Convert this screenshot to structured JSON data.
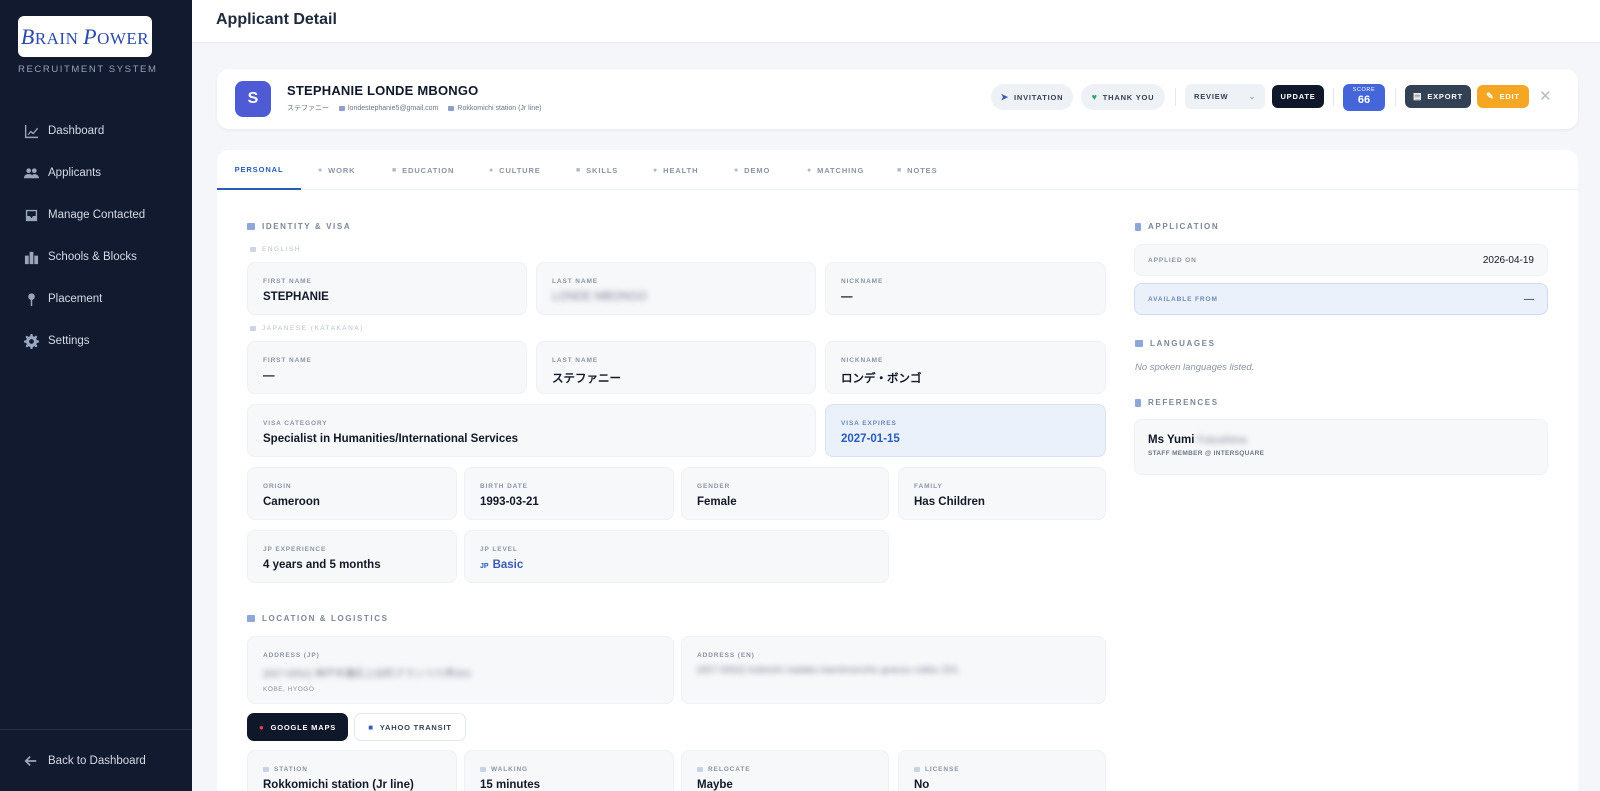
{
  "brand": {
    "logo_text": "BRAIN POWER",
    "subtitle": "RECRUITMENT SYSTEM"
  },
  "sidebar": {
    "items": [
      {
        "label": "Dashboard",
        "icon": "chart-line-icon"
      },
      {
        "label": "Applicants",
        "icon": "users-icon"
      },
      {
        "label": "Manage Contacted",
        "icon": "inbox-icon"
      },
      {
        "label": "Schools & Blocks",
        "icon": "school-icon"
      },
      {
        "label": "Placement",
        "icon": "pin-icon"
      },
      {
        "label": "Settings",
        "icon": "gear-icon"
      }
    ],
    "back_label": "Back to Dashboard"
  },
  "header": {
    "title": "Applicant Detail"
  },
  "profile": {
    "initial": "S",
    "name": "STEPHANIE LONDE MBONGO",
    "kana": "ステファニー",
    "email": "londestephanie5@gmail.com",
    "station": "Rokkomichi station (Jr line)",
    "actions": {
      "invitation": "INVITATION",
      "thank_you": "THANK YOU",
      "status": "REVIEW",
      "update": "UPDATE",
      "score_label": "SCORE",
      "score_value": "66",
      "export": "EXPORT",
      "edit": "EDIT"
    }
  },
  "tabs": [
    "PERSONAL",
    "WORK",
    "EDUCATION",
    "CULTURE",
    "SKILLS",
    "HEALTH",
    "DEMO",
    "MATCHING",
    "NOTES"
  ],
  "identity": {
    "heading": "IDENTITY & VISA",
    "english_label": "ENGLISH",
    "japanese_label": "JAPANESE (KATAKANA)",
    "en_first_label": "FIRST NAME",
    "en_first": "STEPHANIE",
    "en_last_label": "LAST NAME",
    "en_last": "LONDE MBONGO",
    "en_nick_label": "NICKNAME",
    "en_nick": "—",
    "jp_first_label": "FIRST NAME",
    "jp_first": "—",
    "jp_last_label": "LAST NAME",
    "jp_last": "ステファニー",
    "jp_nick_label": "NICKNAME",
    "jp_nick": "ロンデ・ボンゴ",
    "visa_cat_label": "VISA CATEGORY",
    "visa_cat": "Specialist in Humanities/International Services",
    "visa_exp_label": "VISA EXPIRES",
    "visa_exp": "2027-01-15",
    "origin_label": "ORIGIN",
    "origin": "Cameroon",
    "birth_label": "BIRTH DATE",
    "birth": "1993-03-21",
    "gender_label": "GENDER",
    "gender": "Female",
    "family_label": "FAMILY",
    "family": "Has Children",
    "jpexp_label": "JP EXPERIENCE",
    "jpexp": "4 years and 5 months",
    "jplevel_label": "JP LEVEL",
    "jplevel_tag": "JP",
    "jplevel": "Basic"
  },
  "location": {
    "heading": "LOCATION & LOGISTICS",
    "addr_jp_label": "ADDRESS (JP)",
    "addr_jp": "(657-0052) 神戸市灘区上谷町グランツ六甲201",
    "addr_jp_sub": "KOBE, HYOGO",
    "addr_en_label": "ADDRESS (EN)",
    "addr_en": "(657-0052) kobeshi nadaku kamimoncho granzu rokko 201",
    "google_maps": "GOOGLE MAPS",
    "yahoo_transit": "YAHOO TRANSIT",
    "station_label": "STATION",
    "station": "Rokkomichi station (Jr line)",
    "walking_label": "WALKING",
    "walking": "15 minutes",
    "relocate_label": "RELOCATE",
    "relocate": "Maybe",
    "license_label": "LICENSE",
    "license": "No"
  },
  "application": {
    "heading": "APPLICATION",
    "applied_label": "APPLIED ON",
    "applied": "2026-04-19",
    "available_label": "AVAILABLE FROM",
    "available": "—"
  },
  "languages": {
    "heading": "LANGUAGES",
    "empty": "No spoken languages listed."
  },
  "references": {
    "heading": "REFERENCES",
    "name_prefix": "Ms Yumi",
    "name_hidden": "Fukushima",
    "role": "STAFF MEMBER @ INTERSQUARE"
  }
}
